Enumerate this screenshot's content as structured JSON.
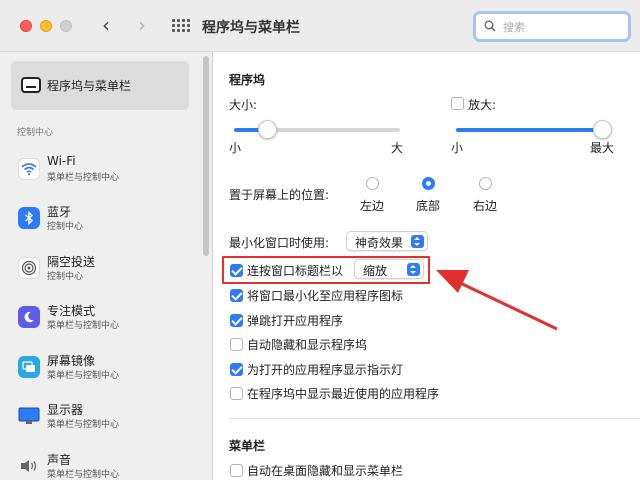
{
  "window": {
    "title": "程序坞与菜单栏"
  },
  "search": {
    "placeholder": "搜索"
  },
  "sidebar": {
    "selected": {
      "label": "程序坞与菜单栏"
    },
    "section_label": "控制中心",
    "items": [
      {
        "title": "Wi-Fi",
        "subtitle": "菜单栏与控制中心",
        "icon": "wifi-icon",
        "color": "#2f7bf5"
      },
      {
        "title": "蓝牙",
        "subtitle": "控制中心",
        "icon": "bluetooth-icon",
        "color": "#2f7bf5"
      },
      {
        "title": "隔空投送",
        "subtitle": "控制中心",
        "icon": "airdrop-icon",
        "color": "#e9e9e9"
      },
      {
        "title": "专注模式",
        "subtitle": "菜单栏与控制中心",
        "icon": "moon-icon",
        "color": "#5e5ce6"
      },
      {
        "title": "屏幕镜像",
        "subtitle": "菜单栏与控制中心",
        "icon": "screen-mirror-icon",
        "color": "#2aa7e6"
      },
      {
        "title": "显示器",
        "subtitle": "菜单栏与控制中心",
        "icon": "display-icon",
        "color": "#2f7bf5"
      },
      {
        "title": "声音",
        "subtitle": "菜单栏与控制中心",
        "icon": "speaker-icon",
        "color": "#e9e9e9"
      }
    ]
  },
  "dock": {
    "header": "程序坞",
    "size": {
      "label": "大小:",
      "min": "小",
      "max": "大",
      "value": 0.2
    },
    "magnification": {
      "label": "放大:",
      "checked": false,
      "min": "小",
      "max": "最大",
      "value": 1.0
    },
    "position": {
      "label": "置于屏幕上的位置:",
      "options": [
        "左边",
        "底部",
        "右边"
      ],
      "selected": "底部"
    },
    "minimize_effect": {
      "label": "最小化窗口时使用:",
      "value": "神奇效果"
    },
    "double_click": {
      "label": "连按窗口标题栏以",
      "value": "缩放",
      "checked": true
    },
    "options": [
      {
        "label": "将窗口最小化至应用程序图标",
        "checked": true
      },
      {
        "label": "弹跳打开应用程序",
        "checked": true
      },
      {
        "label": "自动隐藏和显示程序坞",
        "checked": false
      },
      {
        "label": "为打开的应用程序显示指示灯",
        "checked": true
      },
      {
        "label": "在程序坞中显示最近使用的应用程序",
        "checked": false
      }
    ]
  },
  "menubar": {
    "header": "菜单栏",
    "options": [
      {
        "label": "自动在桌面隐藏和显示菜单栏",
        "checked": false
      }
    ]
  },
  "colors": {
    "accent": "#2f7bf5",
    "highlight": "#e23030"
  }
}
